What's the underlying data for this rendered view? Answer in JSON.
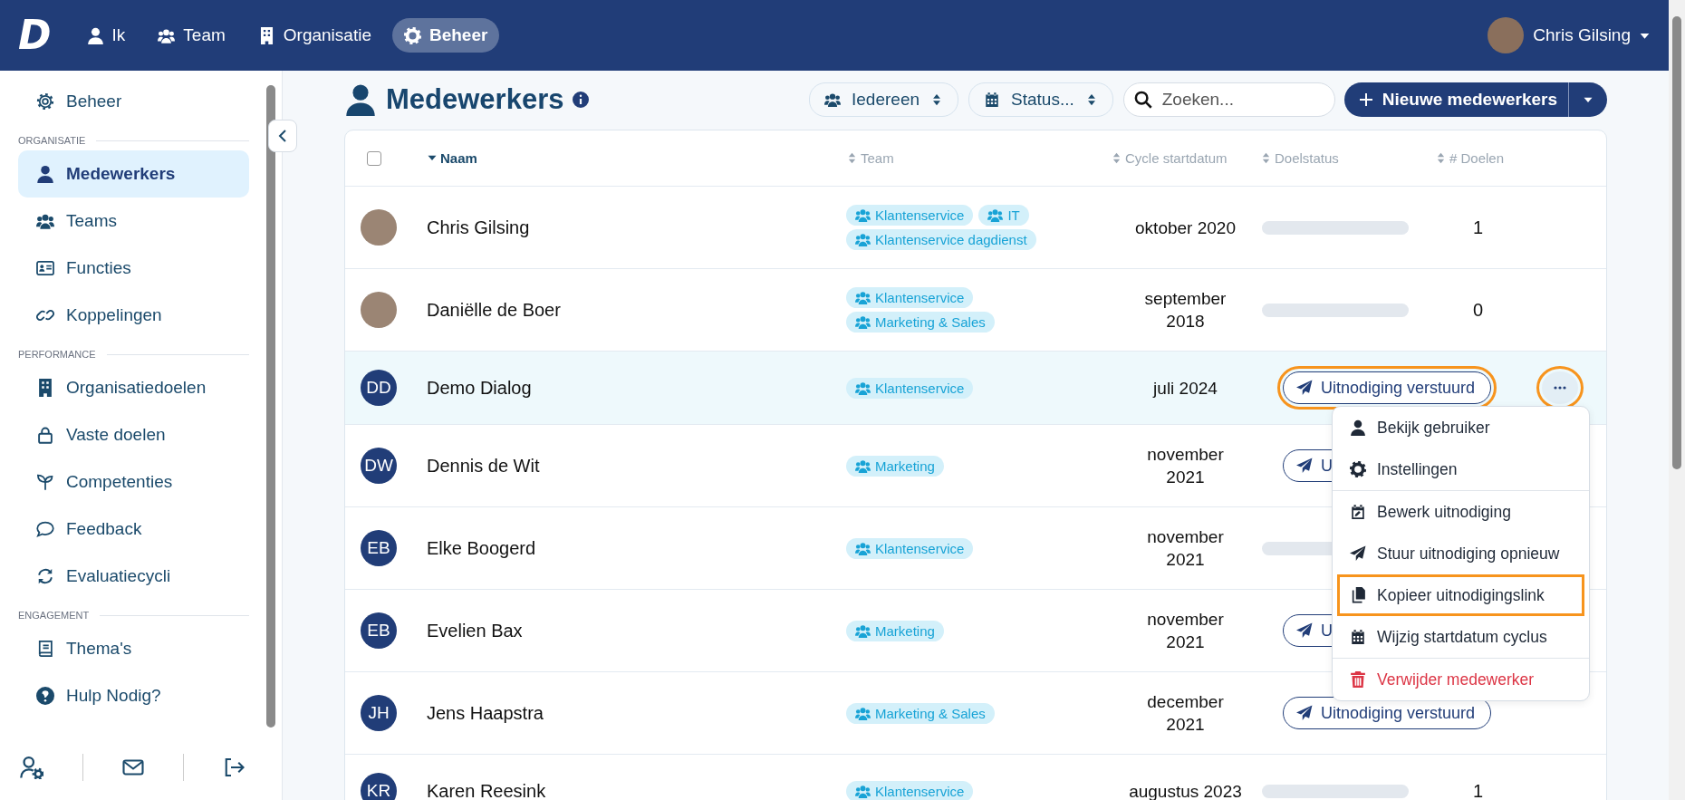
{
  "app": {
    "logo_text": "D"
  },
  "nav": [
    {
      "label": "Ik",
      "selected": false
    },
    {
      "label": "Team",
      "selected": false
    },
    {
      "label": "Organisatie",
      "selected": false
    },
    {
      "label": "Beheer",
      "selected": true
    }
  ],
  "user": {
    "name": "Chris Gilsing"
  },
  "sidebar": {
    "top_item": {
      "label": "Beheer",
      "selected": false
    },
    "sections": [
      {
        "title": "ORGANISATIE",
        "items": [
          {
            "label": "Medewerkers",
            "selected": true
          },
          {
            "label": "Teams",
            "selected": false
          },
          {
            "label": "Functies",
            "selected": false
          },
          {
            "label": "Koppelingen",
            "selected": false
          }
        ]
      },
      {
        "title": "PERFORMANCE",
        "items": [
          {
            "label": "Organisatiedoelen",
            "selected": false
          },
          {
            "label": "Vaste doelen",
            "selected": false
          },
          {
            "label": "Competenties",
            "selected": false
          },
          {
            "label": "Feedback",
            "selected": false
          },
          {
            "label": "Evaluatiecycli",
            "selected": false
          }
        ]
      },
      {
        "title": "ENGAGEMENT",
        "items": [
          {
            "label": "Thema's",
            "selected": false
          }
        ]
      }
    ],
    "help": {
      "label": "Hulp Nodig?"
    }
  },
  "page": {
    "title": "Medewerkers"
  },
  "filters": [
    {
      "label": "Iedereen"
    },
    {
      "label": "Status..."
    }
  ],
  "search": {
    "placeholder": "Zoeken..."
  },
  "new_button": {
    "label": "Nieuwe medewerkers"
  },
  "table": {
    "select_all": {
      "checked": false
    },
    "columns": [
      {
        "label": "Naam",
        "sorted": true
      },
      {
        "label": "Team",
        "sorted": false
      },
      {
        "label": "Cycle startdatum",
        "sorted": false
      },
      {
        "label": "Doelstatus",
        "sorted": false
      },
      {
        "label": "# Doelen",
        "sorted": false
      }
    ],
    "rows": [
      {
        "name": "Chris Gilsing",
        "avatar": {
          "kind": "photo"
        },
        "teams": [
          "Klantenservice",
          "IT",
          "Klantenservice dagdienst"
        ],
        "cycle": "oktober 2020",
        "status": {
          "kind": "bar",
          "level": 0
        },
        "goals": "1",
        "highlighted": false
      },
      {
        "name": "Daniëlle de Boer",
        "avatar": {
          "kind": "photo"
        },
        "teams": [
          "Klantenservice",
          "Marketing & Sales"
        ],
        "cycle": "september 2018",
        "status": {
          "kind": "bar",
          "level": 0
        },
        "goals": "0",
        "highlighted": false
      },
      {
        "name": "Demo Dialog",
        "avatar": {
          "kind": "initials",
          "text": "DD"
        },
        "teams": [
          "Klantenservice"
        ],
        "cycle": "juli 2024",
        "status": {
          "kind": "invite",
          "label": "Uitnodiging verstuurd",
          "marked": true
        },
        "highlighted": true,
        "menu_open": true
      },
      {
        "name": "Dennis de Wit",
        "avatar": {
          "kind": "initials",
          "text": "DW"
        },
        "teams": [
          "Marketing"
        ],
        "cycle": "november 2021",
        "status": {
          "kind": "invite",
          "label": "U",
          "marked": false
        },
        "highlighted": false
      },
      {
        "name": "Elke Boogerd",
        "avatar": {
          "kind": "initials",
          "text": "EB"
        },
        "teams": [
          "Klantenservice"
        ],
        "cycle": "november 2021",
        "status": {
          "kind": "bar",
          "level": 0
        },
        "highlighted": false
      },
      {
        "name": "Evelien Bax",
        "avatar": {
          "kind": "initials",
          "text": "EB"
        },
        "teams": [
          "Marketing"
        ],
        "cycle": "november 2021",
        "status": {
          "kind": "invite",
          "label": "U",
          "marked": false
        },
        "highlighted": false
      },
      {
        "name": "Jens Haapstra",
        "avatar": {
          "kind": "initials",
          "text": "JH"
        },
        "teams": [
          "Marketing & Sales"
        ],
        "cycle": "december 2021",
        "status": {
          "kind": "invite",
          "label": "Uitnodiging verstuurd",
          "marked": false
        },
        "highlighted": false
      },
      {
        "name": "Karen Reesink",
        "avatar": {
          "kind": "initials",
          "text": "KR"
        },
        "teams": [
          "Klantenservice"
        ],
        "cycle": "augustus 2023",
        "status": {
          "kind": "bar",
          "level": 0
        },
        "goals": "1",
        "highlighted": false
      }
    ]
  },
  "row_menu": {
    "marked": true,
    "groups": [
      [
        {
          "label": "Bekijk gebruiker",
          "kind": "normal",
          "marked": false
        },
        {
          "label": "Instellingen",
          "kind": "normal",
          "marked": false
        }
      ],
      [
        {
          "label": "Bewerk uitnodiging",
          "kind": "normal",
          "marked": false
        },
        {
          "label": "Stuur uitnodiging opnieuw",
          "kind": "normal",
          "marked": false
        },
        {
          "label": "Kopieer uitnodigingslink",
          "kind": "normal",
          "marked": true
        },
        {
          "label": "Wijzig startdatum cyclus",
          "kind": "normal",
          "marked": false
        }
      ],
      [
        {
          "label": "Verwijder medewerker",
          "kind": "danger",
          "marked": false
        }
      ]
    ]
  }
}
